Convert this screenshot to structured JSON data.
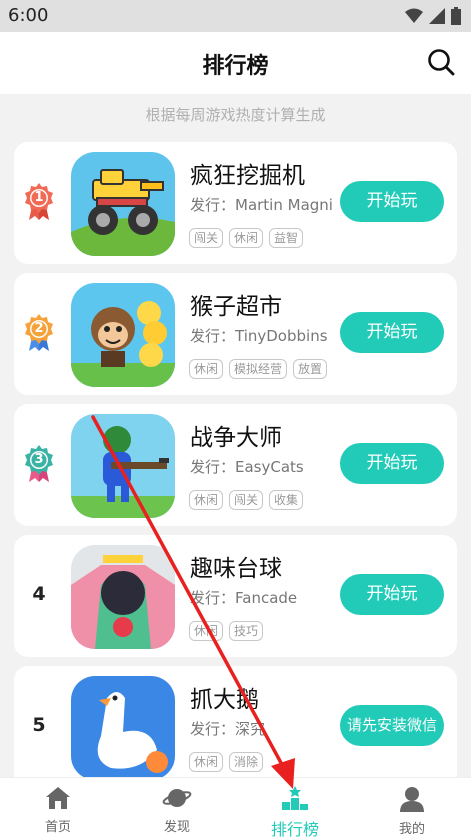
{
  "status": {
    "time": "6:00"
  },
  "header": {
    "title": "排行榜"
  },
  "subtitle": "根据每周游戏热度计算生成",
  "games": [
    {
      "rank": "1",
      "name": "疯狂挖掘机",
      "publisher": "发行：Martin Magni",
      "tags": [
        "闯关",
        "休闲",
        "益智"
      ],
      "button": "开始玩"
    },
    {
      "rank": "2",
      "name": "猴子超市",
      "publisher": "发行：TinyDobbins",
      "tags": [
        "休闲",
        "模拟经营",
        "放置"
      ],
      "button": "开始玩"
    },
    {
      "rank": "3",
      "name": "战争大师",
      "publisher": "发行：EasyCats",
      "tags": [
        "休闲",
        "闯关",
        "收集"
      ],
      "button": "开始玩"
    },
    {
      "rank": "4",
      "name": "趣味台球",
      "publisher": "发行：Fancade",
      "tags": [
        "休闲",
        "技巧"
      ],
      "button": "开始玩"
    },
    {
      "rank": "5",
      "name": "抓大鹅",
      "publisher": "发行：深究",
      "tags": [
        "休闲",
        "消除"
      ],
      "button": "请先安装微信"
    }
  ],
  "nav": {
    "home": "首页",
    "discover": "发现",
    "ranking": "排行榜",
    "mine": "我的"
  },
  "colors": {
    "accent": "#22cbb8",
    "annotation_arrow": "#e82020"
  }
}
